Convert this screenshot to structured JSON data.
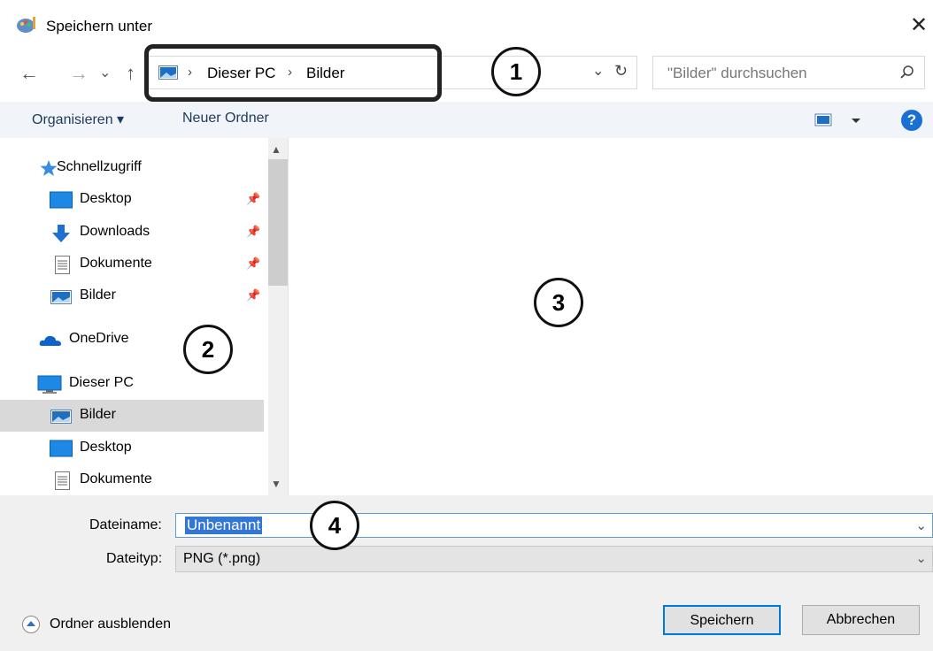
{
  "window": {
    "title": "Speichern unter",
    "close_label": "✕"
  },
  "nav": {
    "back": "←",
    "forward": "→",
    "recent": "⌄",
    "up": "↑",
    "breadcrumb": [
      "Dieser PC",
      "Bilder"
    ],
    "sep": "›",
    "refresh": "↻",
    "dropdown": "⌄"
  },
  "search": {
    "placeholder": "\"Bilder\" durchsuchen"
  },
  "toolbar": {
    "organize_label": "Organisieren ▾",
    "new_folder_label": "Neuer Ordner",
    "help": "?"
  },
  "sidebar": {
    "items": [
      {
        "label": "Schnellzugriff",
        "icon": "star-icon",
        "pinned": false
      },
      {
        "label": "Desktop",
        "icon": "desktop-icon",
        "pinned": true
      },
      {
        "label": "Downloads",
        "icon": "download-icon",
        "pinned": true
      },
      {
        "label": "Dokumente",
        "icon": "document-icon",
        "pinned": true
      },
      {
        "label": "Bilder",
        "icon": "pictures-icon",
        "pinned": true
      },
      {
        "label": "OneDrive",
        "icon": "cloud-icon",
        "pinned": false
      },
      {
        "label": "Dieser PC",
        "icon": "computer-icon",
        "pinned": false
      },
      {
        "label": "Bilder",
        "icon": "pictures-icon",
        "pinned": false,
        "selected": true
      },
      {
        "label": "Desktop",
        "icon": "desktop-icon",
        "pinned": false
      },
      {
        "label": "Dokumente",
        "icon": "document-icon",
        "pinned": false
      }
    ]
  },
  "footer": {
    "filename_label": "Dateiname:",
    "filename_value": "Unbenannt",
    "filetype_label": "Dateityp:",
    "filetype_value": "PNG (*.png)",
    "hide_folders_label": "Ordner ausblenden",
    "save_label": "Speichern",
    "cancel_label": "Abbrechen"
  },
  "annotations": {
    "c1": "1",
    "c2": "2",
    "c3": "3",
    "c4": "4"
  },
  "colors": {
    "accent": "#0078d7",
    "toolbar_bg": "#f1f4f9",
    "footer_bg": "#f0f0f0",
    "selection": "#3377d6"
  }
}
